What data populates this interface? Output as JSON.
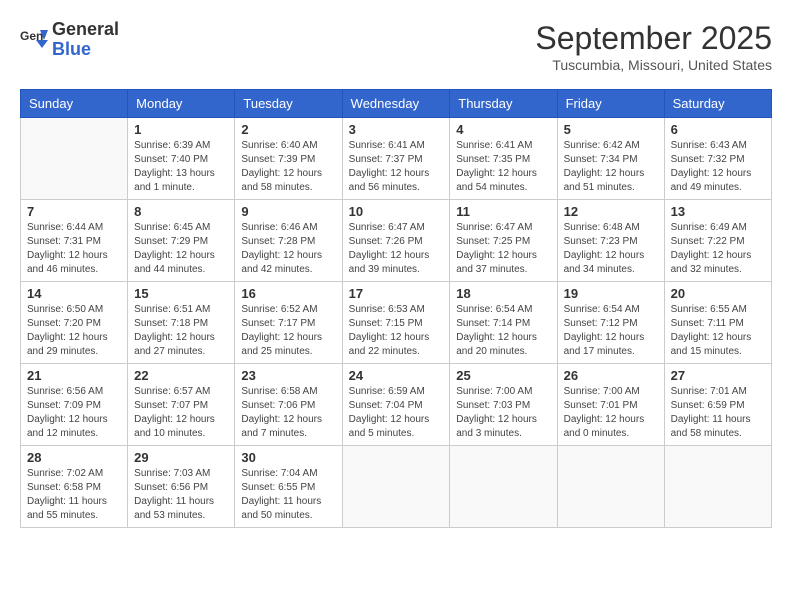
{
  "header": {
    "logo_general": "General",
    "logo_blue": "Blue",
    "month_title": "September 2025",
    "location": "Tuscumbia, Missouri, United States"
  },
  "days_of_week": [
    "Sunday",
    "Monday",
    "Tuesday",
    "Wednesday",
    "Thursday",
    "Friday",
    "Saturday"
  ],
  "weeks": [
    [
      {
        "day": "",
        "info": ""
      },
      {
        "day": "1",
        "info": "Sunrise: 6:39 AM\nSunset: 7:40 PM\nDaylight: 13 hours\nand 1 minute."
      },
      {
        "day": "2",
        "info": "Sunrise: 6:40 AM\nSunset: 7:39 PM\nDaylight: 12 hours\nand 58 minutes."
      },
      {
        "day": "3",
        "info": "Sunrise: 6:41 AM\nSunset: 7:37 PM\nDaylight: 12 hours\nand 56 minutes."
      },
      {
        "day": "4",
        "info": "Sunrise: 6:41 AM\nSunset: 7:35 PM\nDaylight: 12 hours\nand 54 minutes."
      },
      {
        "day": "5",
        "info": "Sunrise: 6:42 AM\nSunset: 7:34 PM\nDaylight: 12 hours\nand 51 minutes."
      },
      {
        "day": "6",
        "info": "Sunrise: 6:43 AM\nSunset: 7:32 PM\nDaylight: 12 hours\nand 49 minutes."
      }
    ],
    [
      {
        "day": "7",
        "info": "Sunrise: 6:44 AM\nSunset: 7:31 PM\nDaylight: 12 hours\nand 46 minutes."
      },
      {
        "day": "8",
        "info": "Sunrise: 6:45 AM\nSunset: 7:29 PM\nDaylight: 12 hours\nand 44 minutes."
      },
      {
        "day": "9",
        "info": "Sunrise: 6:46 AM\nSunset: 7:28 PM\nDaylight: 12 hours\nand 42 minutes."
      },
      {
        "day": "10",
        "info": "Sunrise: 6:47 AM\nSunset: 7:26 PM\nDaylight: 12 hours\nand 39 minutes."
      },
      {
        "day": "11",
        "info": "Sunrise: 6:47 AM\nSunset: 7:25 PM\nDaylight: 12 hours\nand 37 minutes."
      },
      {
        "day": "12",
        "info": "Sunrise: 6:48 AM\nSunset: 7:23 PM\nDaylight: 12 hours\nand 34 minutes."
      },
      {
        "day": "13",
        "info": "Sunrise: 6:49 AM\nSunset: 7:22 PM\nDaylight: 12 hours\nand 32 minutes."
      }
    ],
    [
      {
        "day": "14",
        "info": "Sunrise: 6:50 AM\nSunset: 7:20 PM\nDaylight: 12 hours\nand 29 minutes."
      },
      {
        "day": "15",
        "info": "Sunrise: 6:51 AM\nSunset: 7:18 PM\nDaylight: 12 hours\nand 27 minutes."
      },
      {
        "day": "16",
        "info": "Sunrise: 6:52 AM\nSunset: 7:17 PM\nDaylight: 12 hours\nand 25 minutes."
      },
      {
        "day": "17",
        "info": "Sunrise: 6:53 AM\nSunset: 7:15 PM\nDaylight: 12 hours\nand 22 minutes."
      },
      {
        "day": "18",
        "info": "Sunrise: 6:54 AM\nSunset: 7:14 PM\nDaylight: 12 hours\nand 20 minutes."
      },
      {
        "day": "19",
        "info": "Sunrise: 6:54 AM\nSunset: 7:12 PM\nDaylight: 12 hours\nand 17 minutes."
      },
      {
        "day": "20",
        "info": "Sunrise: 6:55 AM\nSunset: 7:11 PM\nDaylight: 12 hours\nand 15 minutes."
      }
    ],
    [
      {
        "day": "21",
        "info": "Sunrise: 6:56 AM\nSunset: 7:09 PM\nDaylight: 12 hours\nand 12 minutes."
      },
      {
        "day": "22",
        "info": "Sunrise: 6:57 AM\nSunset: 7:07 PM\nDaylight: 12 hours\nand 10 minutes."
      },
      {
        "day": "23",
        "info": "Sunrise: 6:58 AM\nSunset: 7:06 PM\nDaylight: 12 hours\nand 7 minutes."
      },
      {
        "day": "24",
        "info": "Sunrise: 6:59 AM\nSunset: 7:04 PM\nDaylight: 12 hours\nand 5 minutes."
      },
      {
        "day": "25",
        "info": "Sunrise: 7:00 AM\nSunset: 7:03 PM\nDaylight: 12 hours\nand 3 minutes."
      },
      {
        "day": "26",
        "info": "Sunrise: 7:00 AM\nSunset: 7:01 PM\nDaylight: 12 hours\nand 0 minutes."
      },
      {
        "day": "27",
        "info": "Sunrise: 7:01 AM\nSunset: 6:59 PM\nDaylight: 11 hours\nand 58 minutes."
      }
    ],
    [
      {
        "day": "28",
        "info": "Sunrise: 7:02 AM\nSunset: 6:58 PM\nDaylight: 11 hours\nand 55 minutes."
      },
      {
        "day": "29",
        "info": "Sunrise: 7:03 AM\nSunset: 6:56 PM\nDaylight: 11 hours\nand 53 minutes."
      },
      {
        "day": "30",
        "info": "Sunrise: 7:04 AM\nSunset: 6:55 PM\nDaylight: 11 hours\nand 50 minutes."
      },
      {
        "day": "",
        "info": ""
      },
      {
        "day": "",
        "info": ""
      },
      {
        "day": "",
        "info": ""
      },
      {
        "day": "",
        "info": ""
      }
    ]
  ]
}
